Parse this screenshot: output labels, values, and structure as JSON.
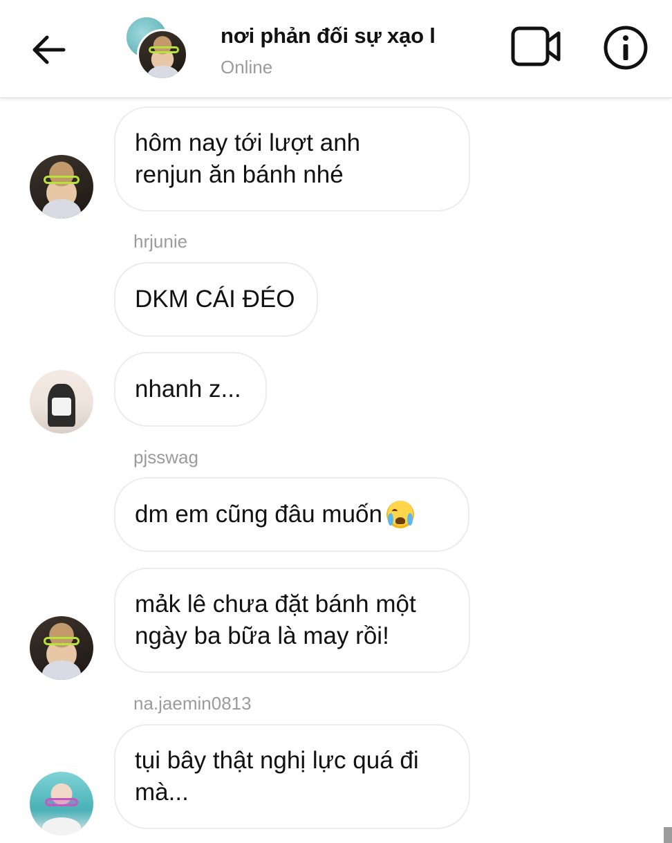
{
  "header": {
    "title": "nơi phản đối sự xạo l",
    "status": "Online",
    "icons": {
      "back": "arrow-left-icon",
      "video": "video-camera-icon",
      "info": "info-icon"
    }
  },
  "messages": [
    {
      "text": "hôm nay tới lượt anh\nrenjun ăn bánh nhé",
      "sender": ""
    },
    {
      "username": "hrjunie",
      "text": "DKM CÁI ĐÉO"
    },
    {
      "text": "nhanh z..."
    },
    {
      "username": "pjsswag",
      "text": "dm em cũng đâu muốn",
      "emoji": "loudly-crying-face"
    },
    {
      "text": "mảk lê chưa đặt bánh một\nngày ba bữa là may rồi!"
    },
    {
      "username": "na.jaemin0813",
      "text": "tụi bây thật nghị lực quá đi\nmà..."
    }
  ],
  "colors": {
    "bubble_border": "#ececec",
    "secondary_text": "#9b9b9b",
    "accent_glasses": "#b9e23a"
  }
}
